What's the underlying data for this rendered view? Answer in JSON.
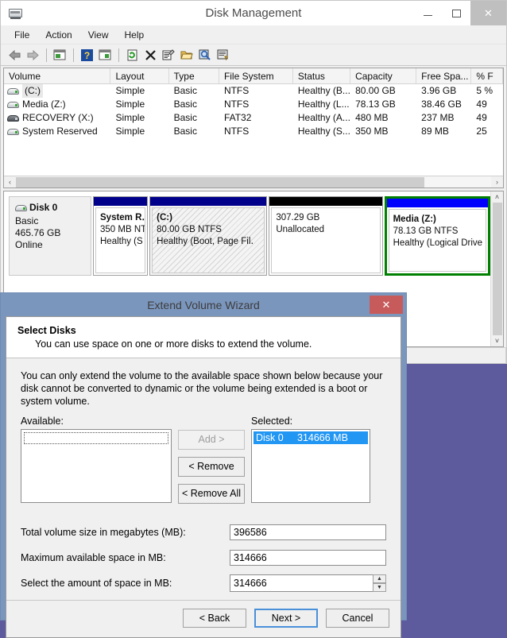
{
  "main_window": {
    "title": "Disk Management",
    "icon": "disk-drive-icon",
    "controls": {
      "minimize": "–",
      "maximize": "□",
      "close": "✕"
    },
    "menubar": [
      "File",
      "Action",
      "View",
      "Help"
    ],
    "toolbar": [
      "back-arrow-icon",
      "forward-arrow-icon",
      "up-folder-icon",
      "help-icon",
      "show-hide-pane-icon",
      "refresh-icon",
      "delete-icon",
      "properties-icon",
      "open-folder-icon",
      "search-icon",
      "rescan-disks-icon"
    ]
  },
  "volume_table": {
    "columns": [
      "Volume",
      "Layout",
      "Type",
      "File System",
      "Status",
      "Capacity",
      "Free Spa...",
      "% F"
    ],
    "rows": [
      {
        "icon": "volume-icon",
        "volume": "(C:)",
        "layout": "Simple",
        "type": "Basic",
        "file_system": "NTFS",
        "status": "Healthy (B...",
        "capacity": "80.00 GB",
        "free_space": "3.96 GB",
        "percent_free": "5 %",
        "selected": true
      },
      {
        "icon": "volume-icon",
        "volume": "Media (Z:)",
        "layout": "Simple",
        "type": "Basic",
        "file_system": "NTFS",
        "status": "Healthy (L...",
        "capacity": "78.13 GB",
        "free_space": "38.46 GB",
        "percent_free": "49",
        "selected": false
      },
      {
        "icon": "recovery-volume-icon",
        "volume": "RECOVERY (X:)",
        "layout": "Simple",
        "type": "Basic",
        "file_system": "FAT32",
        "status": "Healthy (A...",
        "capacity": "480 MB",
        "free_space": "237 MB",
        "percent_free": "49",
        "selected": false
      },
      {
        "icon": "volume-icon",
        "volume": "System Reserved",
        "layout": "Simple",
        "type": "Basic",
        "file_system": "NTFS",
        "status": "Healthy (S...",
        "capacity": "350 MB",
        "free_space": "89 MB",
        "percent_free": "25",
        "selected": false
      }
    ],
    "hscroll": {
      "left_arrow": "‹",
      "right_arrow": "›"
    }
  },
  "disk_view": {
    "disk": {
      "icon": "disk-icon",
      "name": "Disk 0",
      "type": "Basic",
      "size": "465.76 GB",
      "state": "Online"
    },
    "partitions": [
      {
        "name": "System R․",
        "size_fs": "350 MB NT",
        "status": "Healthy (S",
        "cap_color": "blue",
        "hatched": false,
        "selected": false,
        "width_pct": 14
      },
      {
        "name": "(C:)",
        "size_fs": "80.00 GB NTFS",
        "status": "Healthy (Boot, Page Fil․",
        "cap_color": "blue",
        "hatched": true,
        "selected": false,
        "width_pct": 30
      },
      {
        "name": "",
        "size_fs": "307.29 GB",
        "status": "Unallocated",
        "cap_color": "black",
        "hatched": false,
        "selected": false,
        "width_pct": 29
      },
      {
        "name": "Media  (Z:)",
        "size_fs": "78.13 GB NTFS",
        "status": "Healthy (Logical Drive",
        "cap_color": "brightblue",
        "hatched": false,
        "selected": true,
        "width_pct": 27
      }
    ],
    "vscroll": {
      "up_arrow": "˄",
      "down_arrow": "˅"
    }
  },
  "wizard": {
    "title": "Extend Volume Wizard",
    "close_label": "✕",
    "page_title": "Select Disks",
    "page_subtitle": "You can use space on one or more disks to extend the volume.",
    "note": "You can only extend the volume to the available space shown below because your disk cannot be converted to dynamic or the volume being extended is a boot or system volume.",
    "available_label": "Available:",
    "selected_label": "Selected:",
    "available_items": [],
    "selected_items": [
      {
        "disk": "Disk 0",
        "size": "314666 MB"
      }
    ],
    "transfer_buttons": [
      {
        "label": "Add >",
        "disabled": true
      },
      {
        "label": "< Remove",
        "disabled": false
      },
      {
        "label": "< Remove All",
        "disabled": false
      }
    ],
    "fields": [
      {
        "label": "Total volume size in megabytes (MB):",
        "value": "396586",
        "spinner": false
      },
      {
        "label": "Maximum available space in MB:",
        "value": "314666",
        "spinner": false
      },
      {
        "label": "Select the amount of space in MB:",
        "value": "314666",
        "spinner": true
      }
    ],
    "spinner": {
      "up": "▲",
      "down": "▼"
    },
    "footer_buttons": [
      {
        "label": "< Back",
        "default": false
      },
      {
        "label": "Next >",
        "default": true
      },
      {
        "label": "Cancel",
        "default": false
      }
    ]
  }
}
